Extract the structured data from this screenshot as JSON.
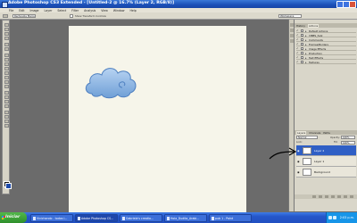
{
  "window": {
    "title": "Adobe Photoshop CS3 Extended - [Untitled-2 @ 16.7% (Layer 2, RGB/8)]"
  },
  "menubar": {
    "items": [
      "File",
      "Edit",
      "Image",
      "Layer",
      "Select",
      "Filter",
      "Analysis",
      "View",
      "Window",
      "Help"
    ]
  },
  "options_bar": {
    "mode_value": "Rectangle Marquee",
    "checkbox_label": "Show Transform Controls",
    "workspace_label": "Workspace"
  },
  "panels": {
    "top_tabs": [
      {
        "label": "History",
        "active": false
      },
      {
        "label": "Actions",
        "active": true
      }
    ],
    "actions": [
      "Default Actions",
      "VIBES_fuzz",
      "Commands",
      "Frames/Borders",
      "Image Effects",
      "Production",
      "Text Effects",
      "Textures"
    ],
    "layer_tabs": [
      {
        "label": "Layers",
        "active": true
      },
      {
        "label": "Channels",
        "active": false
      },
      {
        "label": "Paths",
        "active": false
      }
    ],
    "blend_mode": "Normal",
    "opacity_label": "Opacity:",
    "opacity_value": "100%",
    "lock_label": "Lock:",
    "fill_label": "Fill:",
    "fill_value": "100%",
    "layers": [
      {
        "name": "Layer 2",
        "selected": true
      },
      {
        "name": "Layer 1",
        "selected": false
      },
      {
        "name": "Background",
        "selected": false
      }
    ]
  },
  "taskbar": {
    "start_label": "Iniciar",
    "tasks": [
      {
        "label": "Vivichando - todos l...",
        "active": false
      },
      {
        "label": "Adobe Photoshop CS...",
        "active": true
      },
      {
        "label": "Gabriela's creatio...",
        "active": false
      },
      {
        "label": "Hola_Dudita_Arabi...",
        "active": false
      },
      {
        "label": "pub 1 - Paint",
        "active": false
      }
    ],
    "clock": "2:03 p.m."
  },
  "colors": {
    "accent": "#2f5fc5",
    "cloud_fill": "#8fb8e6",
    "canvas": "#f6f5ea"
  }
}
